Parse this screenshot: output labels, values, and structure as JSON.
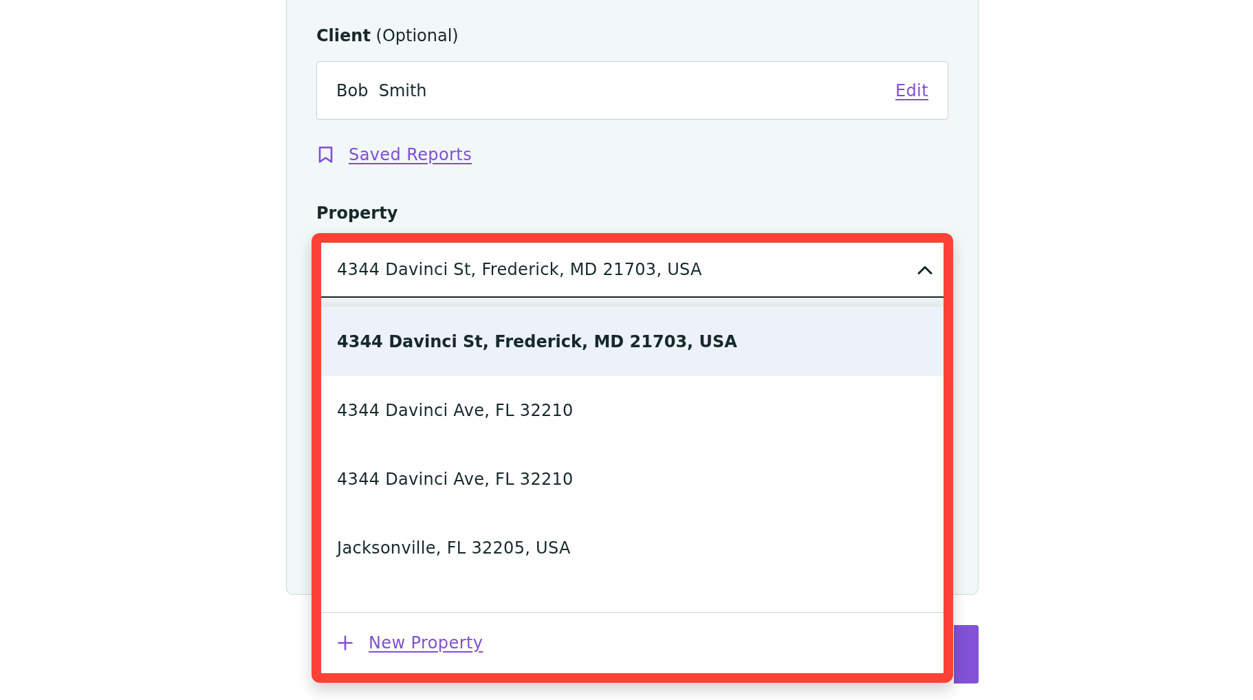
{
  "client": {
    "label": "**Client** (Optional)",
    "value": "Bob  Smith",
    "edit_link": "Edit"
  },
  "saved_reports_link": "Saved Reports",
  "property": {
    "label": "Property",
    "highlighted": true,
    "value": "4344 Davinci St, Frederick, MD 21703, USA",
    "expanded": true,
    "options": [
      {
        "label": "4344 Davinci St, Frederick, MD 21703, USA",
        "selected": true
      },
      {
        "label": "4344 Davinci Ave, FL 32210",
        "selected": false
      },
      {
        "label": "4344 Davinci Ave, FL 32210",
        "selected": false
      },
      {
        "label": "Jacksonville, FL 32205, USA",
        "selected": false
      }
    ],
    "new_property_link": "New Property"
  }
}
